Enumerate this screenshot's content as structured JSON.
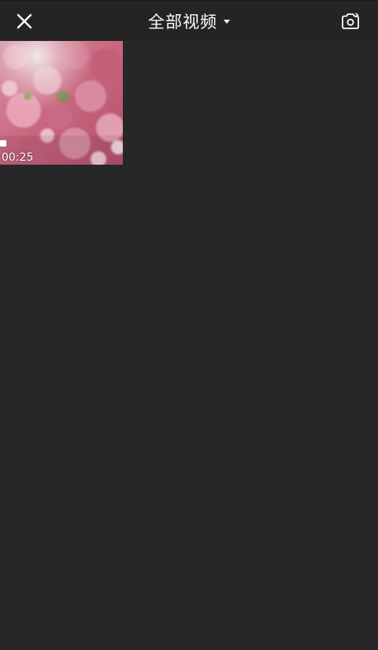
{
  "header": {
    "title": "全部视频",
    "close_icon": "close-icon",
    "dropdown_icon": "caret-down-icon",
    "camera_icon": "camera-switch-icon"
  },
  "media": {
    "items": [
      {
        "duration": "00:25",
        "thumbnail": "cherry-blossom-photo"
      }
    ]
  },
  "colors": {
    "background": "#272727",
    "topbar": "#242424",
    "text": "#ffffff"
  }
}
